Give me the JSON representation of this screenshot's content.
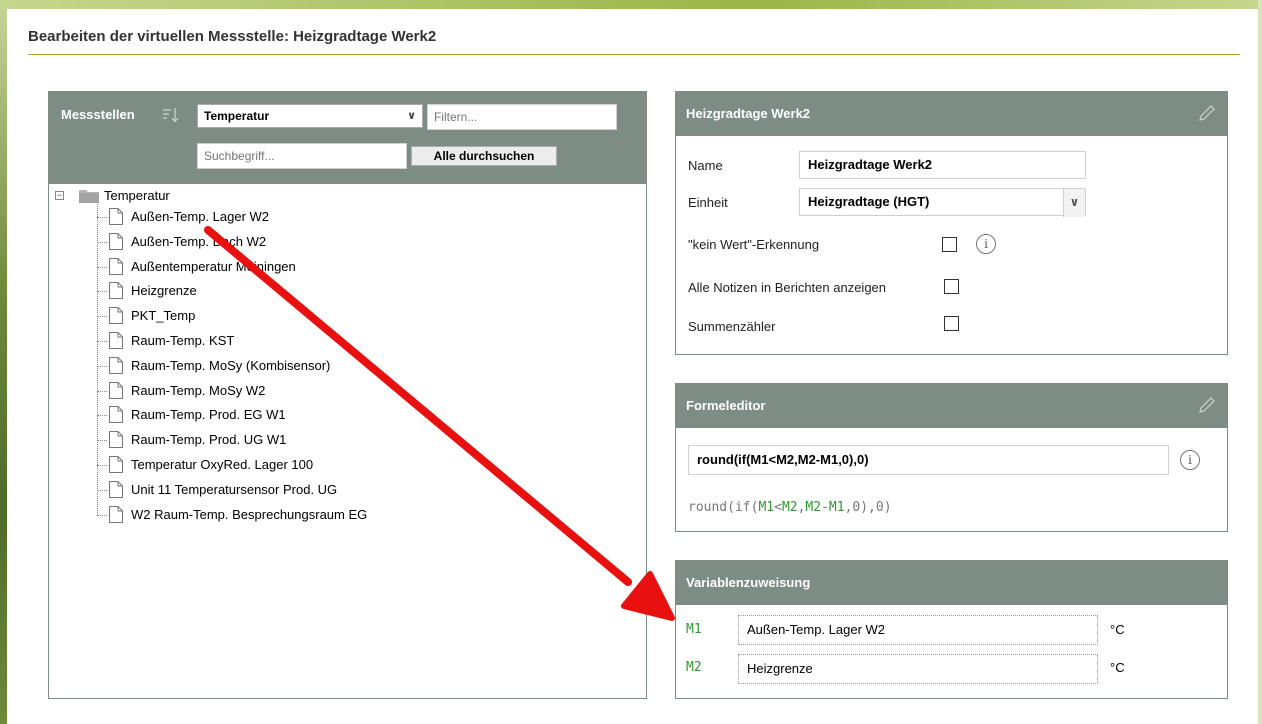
{
  "page": {
    "title": "Bearbeiten der virtuellen Messstelle: Heizgradtage Werk2"
  },
  "tree_panel": {
    "label": "Messstellen",
    "category_select": "Temperatur",
    "filter_placeholder": "Filtern...",
    "search_placeholder": "Suchbegriff...",
    "search_all_button": "Alle durchsuchen",
    "root": "Temperatur",
    "items": [
      "Außen-Temp. Lager W2",
      "Außen-Temp. Dach W2",
      "Außentemperatur Meiningen",
      "Heizgrenze",
      "PKT_Temp",
      "Raum-Temp. KST",
      "Raum-Temp. MoSy (Kombisensor)",
      "Raum-Temp. MoSy W2",
      "Raum-Temp. Prod. EG W1",
      "Raum-Temp. Prod. UG W1",
      "Temperatur OxyRed. Lager 100",
      "Unit 11 Temperatursensor Prod. UG",
      "W2 Raum-Temp. Besprechungsraum EG"
    ]
  },
  "properties": {
    "title": "Heizgradtage Werk2",
    "name_label": "Name",
    "name_value": "Heizgradtage Werk2",
    "unit_label": "Einheit",
    "unit_value": "Heizgradtage (HGT)",
    "no_value_label": "\"kein Wert\"-Erkennung",
    "notes_label": "Alle Notizen in Berichten anzeigen",
    "counter_label": "Summenzähler",
    "info_glyph": "i"
  },
  "formula": {
    "title": "Formeleditor",
    "value": "round(if(M1<M2,M2-M1,0),0)",
    "preview": {
      "p1": "round(if(",
      "v1": "M1",
      "p2": "<",
      "v2": "M2",
      "p3": ",",
      "v3": "M2",
      "p4": "-",
      "v4": "M1",
      "p5": ",0),0)"
    }
  },
  "variables": {
    "title": "Variablenzuweisung",
    "rows": [
      {
        "name": "M1",
        "value": "Außen-Temp. Lager W2",
        "unit": "°C"
      },
      {
        "name": "M2",
        "value": "Heizgrenze",
        "unit": "°C"
      }
    ]
  },
  "colors": {
    "panel_header": "#7e8c86",
    "accent_green": "#8fb33b",
    "variable_green": "#2e9a2e",
    "arrow_red": "#e8110f"
  },
  "icons": {
    "edit": "pencil-icon",
    "sort": "sort-icon",
    "info": "info-icon",
    "folder": "folder-icon",
    "document": "document-icon"
  }
}
